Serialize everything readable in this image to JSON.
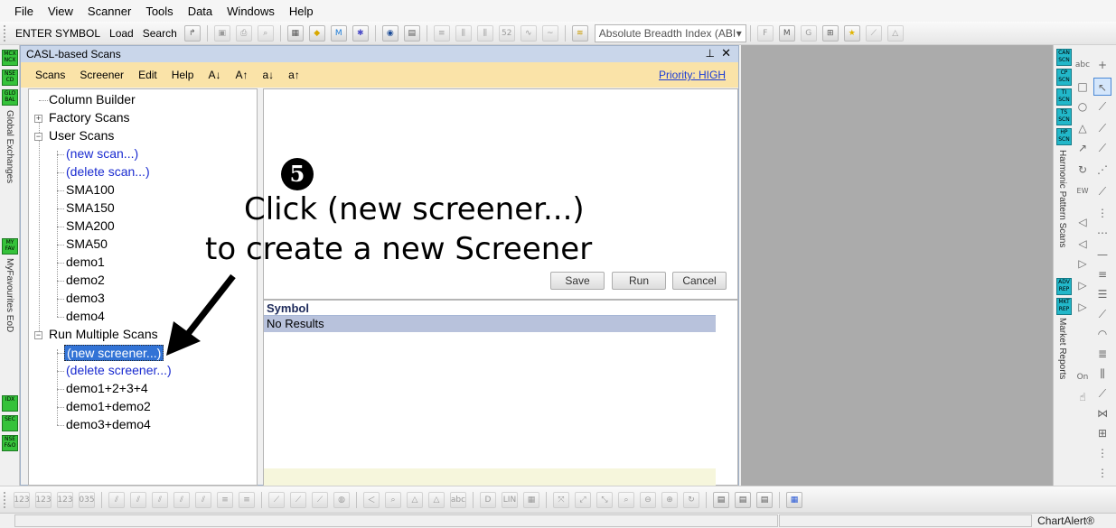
{
  "menu": [
    "File",
    "View",
    "Scanner",
    "Tools",
    "Data",
    "Windows",
    "Help"
  ],
  "toolbar": {
    "enter_symbol": "ENTER SYMBOL",
    "load": "Load",
    "search": "Search",
    "indicator_combo": "Absolute Breadth Index (ABI"
  },
  "left_strip": {
    "badges": [
      "MCX NCX",
      "NSE CD",
      "GLO BAL",
      "MY FAV",
      "IDX",
      "SEC",
      "NSE F&O"
    ],
    "labels": [
      "Global Exchanges",
      "MyFavourites EoD"
    ]
  },
  "casl": {
    "title": "CASL-based Scans",
    "pin": "⊥",
    "close": "✕",
    "menu": [
      "Scans",
      "Screener",
      "Edit",
      "Help",
      "A↓",
      "A↑",
      "a↓",
      "a↑"
    ],
    "priority": "Priority: HIGH"
  },
  "tree": {
    "column_builder": "Column Builder",
    "factory_scans": "Factory Scans",
    "user_scans": "User Scans",
    "user_items": [
      "(new scan...)",
      "(delete scan...)",
      "SMA100",
      "SMA150",
      "SMA200",
      "SMA50",
      "demo1",
      "demo2",
      "demo3",
      "demo4"
    ],
    "run_multiple": "Run Multiple Scans",
    "multi_items": [
      "(new screener...)",
      "(delete screener...)",
      "demo1+2+3+4",
      "demo1+demo2",
      "demo3+demo4"
    ]
  },
  "editor": {
    "save": "Save",
    "run": "Run",
    "cancel": "Cancel"
  },
  "results": {
    "header": "Symbol",
    "row": "No Results"
  },
  "annotation": {
    "step": "5",
    "line1": "Click (new screener...)",
    "line2": "to create a new Screener"
  },
  "right_strip": {
    "badges": [
      "CAN SCN",
      "CP SCN",
      "TI SCN",
      "TS SCN",
      "HP SCN",
      "ADV REP",
      "MKT REP"
    ],
    "labels": [
      "Harmonic Pattern Scans",
      "Market Reports"
    ]
  },
  "status": {
    "brand": "ChartAlert®"
  }
}
